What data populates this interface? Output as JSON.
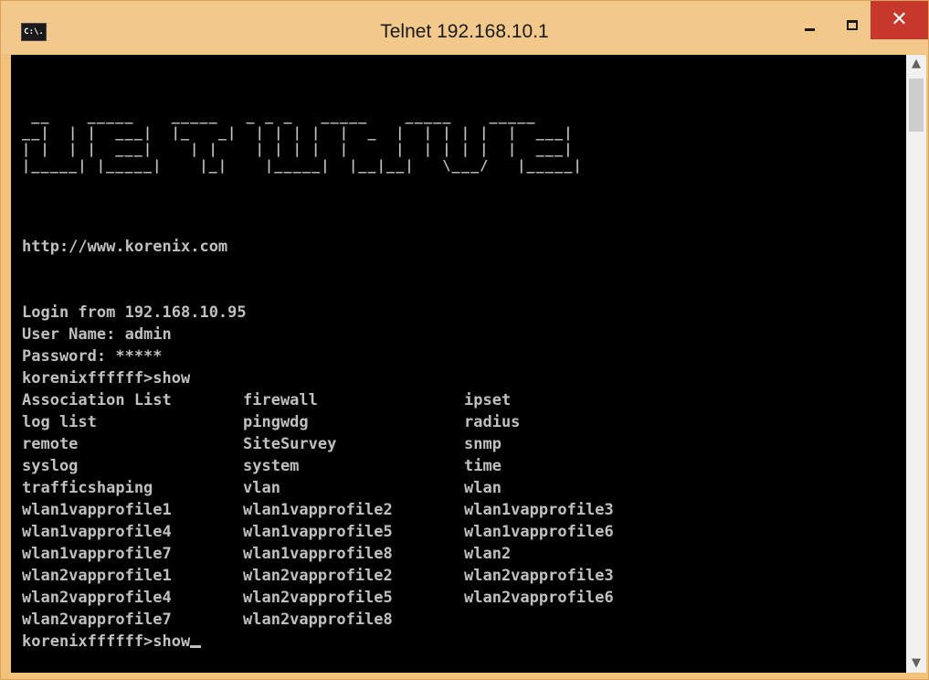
{
  "window": {
    "title": "Telnet 192.168.10.1",
    "icon": "cmd-console-icon",
    "icon_text": "C:\\.",
    "controls": {
      "minimize": "minimize-icon",
      "maximize": "maximize-icon",
      "close_symbol": "✕"
    }
  },
  "colors": {
    "titlebar": "#f2c98a",
    "console_bg": "#000000",
    "console_text": "#c0c0c0",
    "close_button": "#c7372c"
  },
  "terminal": {
    "banner_logo": "JETWAVE",
    "url": "http://www.korenix.com",
    "login_lines": [
      "Login from 192.168.10.95",
      "User Name: admin",
      "Password: *****",
      "korenixffffff>show"
    ],
    "show_items": [
      [
        "Association List",
        "firewall",
        "ipset"
      ],
      [
        "log list",
        "pingwdg",
        "radius"
      ],
      [
        "remote",
        "SiteSurvey",
        "snmp"
      ],
      [
        "syslog",
        "system",
        "time"
      ],
      [
        "trafficshaping",
        "vlan",
        "wlan"
      ],
      [
        "wlan1vapprofile1",
        "wlan1vapprofile2",
        "wlan1vapprofile3"
      ],
      [
        "wlan1vapprofile4",
        "wlan1vapprofile5",
        "wlan1vapprofile6"
      ],
      [
        "wlan1vapprofile7",
        "wlan1vapprofile8",
        "wlan2"
      ],
      [
        "wlan2vapprofile1",
        "wlan2vapprofile2",
        "wlan2vapprofile3"
      ],
      [
        "wlan2vapprofile4",
        "wlan2vapprofile5",
        "wlan2vapprofile6"
      ],
      [
        "wlan2vapprofile7",
        "wlan2vapprofile8",
        ""
      ]
    ],
    "prompt": "korenixffffff>show"
  },
  "scrollbar": {
    "up": "▲",
    "down": "▼"
  }
}
